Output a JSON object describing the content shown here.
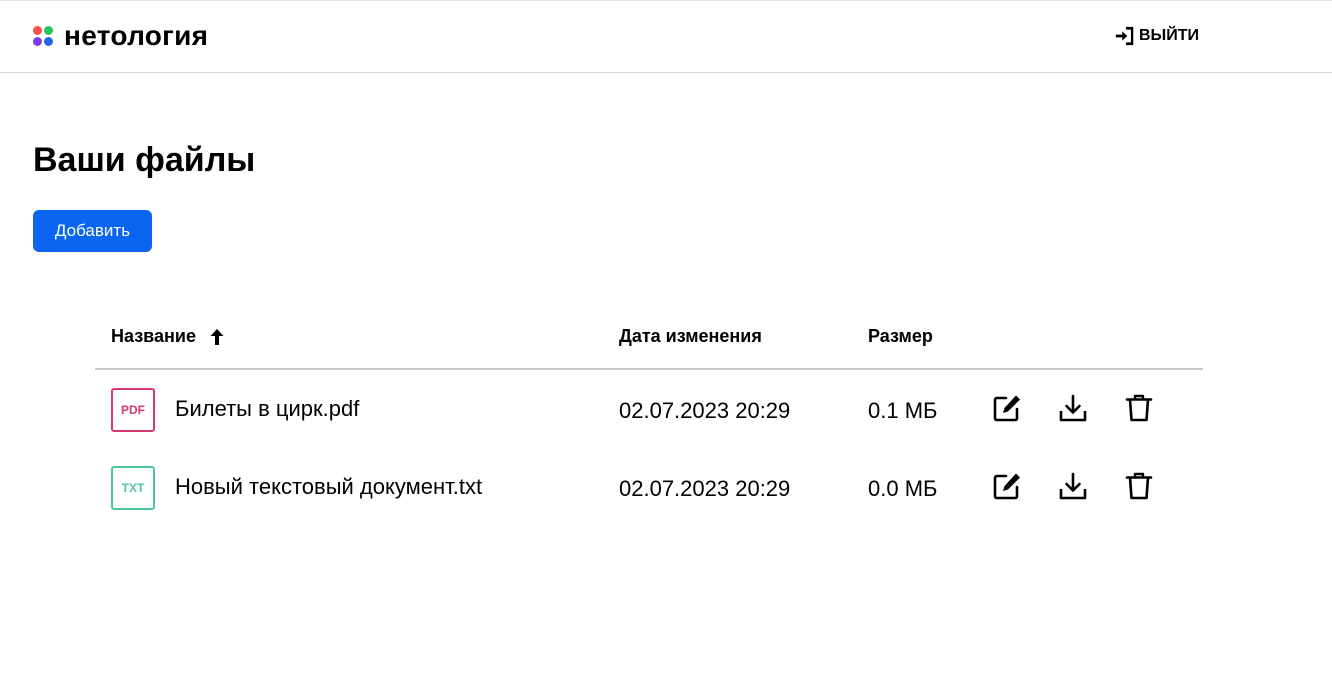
{
  "header": {
    "logo_text": "нетология",
    "logout_label": "ВЫЙТИ",
    "logo_colors": [
      "#ff4d4d",
      "#22c55e",
      "#7c3aed",
      "#2563eb"
    ]
  },
  "main": {
    "title": "Ваши файлы",
    "add_button_label": "Добавить",
    "accent_color": "#0a66f0"
  },
  "table": {
    "columns": {
      "name": "Название",
      "date": "Дата изменения",
      "size": "Размер"
    },
    "sort": {
      "column": "name",
      "direction": "asc",
      "icon": "arrow-up-icon"
    },
    "rows": [
      {
        "type": "PDF",
        "type_color": "#d63a6e",
        "name": "Билеты в цирк.pdf",
        "date": "02.07.2023 20:29",
        "size": "0.1 МБ"
      },
      {
        "type": "TXT",
        "type_color": "#4cc7a0",
        "name": "Новый текстовый документ.txt",
        "date": "02.07.2023 20:29",
        "size": "0.0 МБ"
      }
    ],
    "actions": [
      "edit-icon",
      "download-icon",
      "trash-icon"
    ]
  }
}
